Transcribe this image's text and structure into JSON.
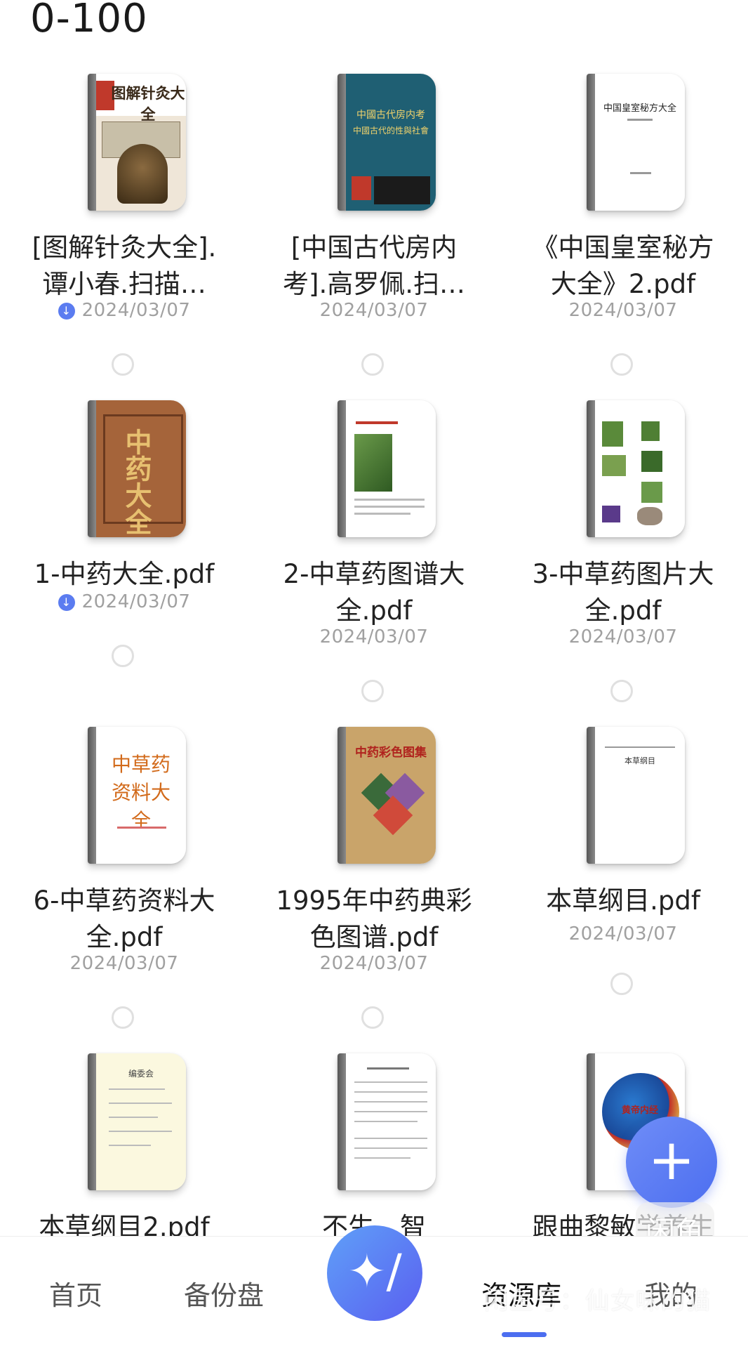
{
  "folder": {
    "title": "0-100"
  },
  "files": [
    {
      "name": "[图解针灸大全].谭小春.扫描…",
      "date": "2024/03/07",
      "downloaded": true,
      "cover_text": "图解针灸大全"
    },
    {
      "name": "[中国古代房内考].高罗佩.扫…",
      "date": "2024/03/07",
      "downloaded": false,
      "cover_text": "中國古代房内考"
    },
    {
      "name": "《中国皇室秘方大全》2.pdf",
      "date": "2024/03/07",
      "downloaded": false,
      "cover_text": "中国皇室秘方大全"
    },
    {
      "name": "1-中药大全.pdf",
      "date": "2024/03/07",
      "downloaded": true,
      "cover_text": "中药大全"
    },
    {
      "name": "2-中草药图谱大全.pdf",
      "date": "2024/03/07",
      "downloaded": false,
      "cover_text": ""
    },
    {
      "name": "3-中草药图片大全.pdf",
      "date": "2024/03/07",
      "downloaded": false,
      "cover_text": ""
    },
    {
      "name": "6-中草药资料大全.pdf",
      "date": "2024/03/07",
      "downloaded": false,
      "cover_text": "中草药资料大全"
    },
    {
      "name": "1995年中药典彩色图谱.pdf",
      "date": "2024/03/07",
      "downloaded": false,
      "cover_text": "中药彩色图集"
    },
    {
      "name": "本草纲目.pdf",
      "date": "2024/03/07",
      "downloaded": false,
      "cover_text": "本草纲目"
    },
    {
      "name": "本草纲目2.pdf",
      "date": "",
      "downloaded": false,
      "cover_text": "编委会"
    },
    {
      "name": "不生…智",
      "date": "",
      "downloaded": false,
      "cover_text": ""
    },
    {
      "name": "跟曲黎敏学养生",
      "date": "",
      "downloaded": false,
      "cover_text": "黄帝内经"
    }
  ],
  "fab": {
    "icon": "plus-icon",
    "symbol": "+"
  },
  "tabbar": {
    "tabs": [
      {
        "label": "首页"
      },
      {
        "label": "备份盘"
      },
      {
        "label": "资源库"
      },
      {
        "label": "我的"
      }
    ],
    "ai_symbol": "✦/",
    "active": "资源库"
  },
  "watermark": {
    "text": "闲鱼号：仙女味的猫",
    "logo": "闲鱼"
  },
  "colors": {
    "accent": "#4c6ef0",
    "date_gray": "#a0a0a0",
    "badge": "#5b7cf0"
  }
}
